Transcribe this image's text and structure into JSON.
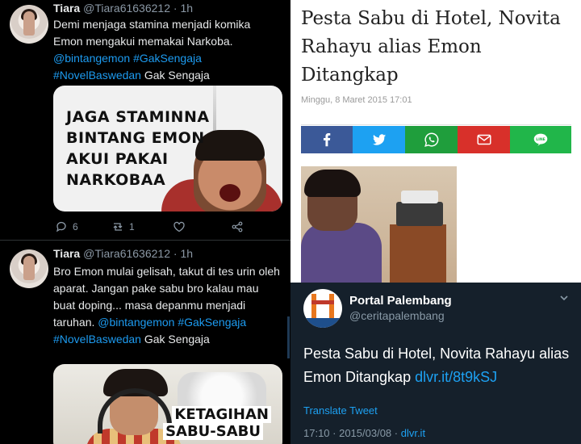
{
  "tweets": [
    {
      "name": "Tiara",
      "handle": "@Tiara61636212",
      "time": "1h",
      "text_plain": "Demi menjaga stamina menjadi komika Emon mengakui memakai Narkoba.",
      "links": [
        "@bintangemon",
        "#GakSengaja",
        "#NovelBaswedan"
      ],
      "text_tail": "Gak Sengaja",
      "media_text": [
        "JAGA STAMINNA",
        "BINTANG EMON",
        "AKUI PAKAI",
        "NARKOBAA"
      ],
      "replies": "6",
      "retweets": "1"
    },
    {
      "name": "Tiara",
      "handle": "@Tiara61636212",
      "time": "1h",
      "text_plain": "Bro Emon mulai gelisah, takut di tes urin oleh aparat. Jangan pake sabu bro kalau mau buat doping... masa depanmu menjadi taruhan.",
      "links": [
        "@bintangemon",
        "#GakSengaja",
        "#NovelBaswedan"
      ],
      "text_tail": "Gak Sengaja",
      "media_text": [
        "KETAGIHAN",
        "SABU-SABU"
      ]
    }
  ],
  "article": {
    "title": "Pesta Sabu di Hotel, Novita Rahayu alias Emon Ditangkap",
    "date": "Minggu, 8 Maret 2015 17:01",
    "share_buttons": [
      {
        "icon": "facebook-icon",
        "color": "#3b5998"
      },
      {
        "icon": "twitter-icon",
        "color": "#1da1f2"
      },
      {
        "icon": "whatsapp-icon",
        "color": "#1f9e3c"
      },
      {
        "icon": "email-icon",
        "color": "#d8302a"
      },
      {
        "icon": "line-icon",
        "color": "#21b64a"
      }
    ]
  },
  "portal_tweet": {
    "name": "Portal Palembang",
    "handle": "@ceritapalembang",
    "text": "Pesta Sabu di Hotel, Novita Rahayu alias Emon Ditangkap",
    "link": "dlvr.it/8t9kSJ",
    "translate": "Translate Tweet",
    "timestamp": "17:10 · 2015/03/08 ·",
    "source": "dlvr.it"
  },
  "colors": {
    "tweet_bg": "#000000",
    "link_blue": "#1d9bf0",
    "portal_bg": "#15202b"
  }
}
